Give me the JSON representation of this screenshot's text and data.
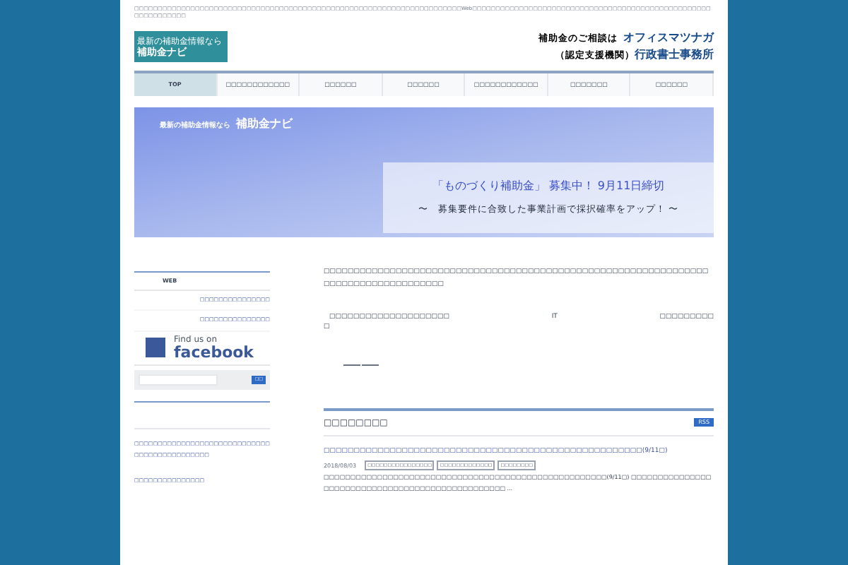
{
  "top_notice": "□□□□□□□□□□□□□□□□□□□□□□□□□□□□□□□□□□□□□□□□□□□□□□□□□□□□□□□□□□□□□□□□□□□□□□Web□□□□□□□□□□□□□□□□□□□□□□□□□□□□□□□□□□□□□□□□□□□□□□□□□□□□□□□□□□□□□□",
  "logo": {
    "line1": "最新の補助金情報なら",
    "line2": "補助金ナビ"
  },
  "header_contact": {
    "lead": "補助金のご相談は",
    "name": "オフィスマツナガ",
    "sub": "（認定支援機関）",
    "office": "行政書士事務所"
  },
  "nav": [
    {
      "label": "TOP",
      "selected": true
    },
    {
      "label": "□□□□□□□□□□□□",
      "selected": false
    },
    {
      "label": "□□□□□□",
      "selected": false
    },
    {
      "label": "□□□□□□",
      "selected": false
    },
    {
      "label": "□□□□□□□□□□□□",
      "selected": false
    },
    {
      "label": "□□□□□□□",
      "selected": false
    },
    {
      "label": "□□□□□□",
      "selected": false
    }
  ],
  "banner": {
    "tagline": "最新の補助金情報なら",
    "brand": "補助金ナビ",
    "headline": "「ものづくり補助金」 募集中！ 9月11日締切",
    "subline": "〜　募集要件に合致した事業計画で採択確率をアップ！ 〜"
  },
  "sidebar": {
    "heading": "WEB",
    "links": [
      "□□□□□□□□□□□□□□□",
      "□□□□□□□□□□□□□□□"
    ],
    "facebook": {
      "small": "Find us on",
      "brand": "facebook"
    },
    "search_button": "□□",
    "posts": [
      "□□□□□□□□□□□□□□□□□□□□□□□□□□□□□□□□□□□□□□□□□□□□□",
      "□□□□□□□□□□□□□□□"
    ]
  },
  "intro": {
    "paragraph": "□□□□□□□□□□□□□□□□□□□□□□□□□□□□□□□□□□□□□□□□□□□□□□□□□□□□□□□□□□□□□□□□□□□□□□□□□□□□□□□□□□□□",
    "line_parts": [
      "□□□□□□□□□□□□□□□□□□□□",
      "IT",
      "□□□□□□□□□"
    ],
    "line_tail": "□"
  },
  "news": {
    "title": "□□□□□□□□",
    "rss": "RSS",
    "post": {
      "title": "□□□□□□□□□□□□□□□□□□□□□□□□□□□□□□□□□□□□□□□□□□□□□□□□□□□□□(9/11□)",
      "date": "2018/08/03",
      "tags": [
        "□□□□□□□□□□□□□□□□",
        "□□□□□□□□□□□□□",
        "□□□□□□□□"
      ],
      "excerpt": "□□□□□□□□□□□□□□□□□□□□□□□□□□□□□□□□□□□□□□□□□□□□□□□□□□□□□(9/11□) □□□□□□□□□□□□□□□□□□□□□□□□□□□□□□□□□□□□□□□□□□□□□□□□□ ..."
    }
  }
}
